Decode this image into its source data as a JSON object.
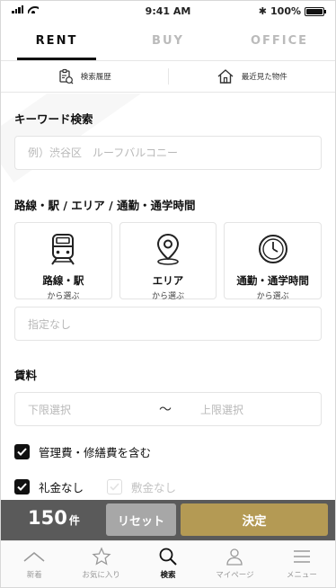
{
  "status": {
    "time": "9:41 AM",
    "battery": "100%"
  },
  "tabs": [
    {
      "label": "RENT",
      "active": true
    },
    {
      "label": "BUY",
      "active": false
    },
    {
      "label": "OFFICE",
      "active": false
    }
  ],
  "history": {
    "search_history": "検索履歴",
    "recently_viewed": "最近見た物件"
  },
  "keyword": {
    "title": "キーワード検索",
    "placeholder": "例）渋谷区　ルーフバルコニー"
  },
  "route": {
    "title": "路線・駅 / エリア / 通勤・通学時間",
    "cards": [
      {
        "label": "路線・駅",
        "sub": "から選ぶ",
        "icon": "train-icon"
      },
      {
        "label": "エリア",
        "sub": "から選ぶ",
        "icon": "map-pin-icon"
      },
      {
        "label": "通勤・通学時間",
        "sub": "から選ぶ",
        "icon": "clock-icon"
      }
    ],
    "selection": "指定なし"
  },
  "rent": {
    "title": "賃料",
    "min_placeholder": "下限選択",
    "separator": "～",
    "max_placeholder": "上限選択"
  },
  "options": [
    {
      "label": "管理費・修繕費を含む",
      "checked": true
    },
    {
      "label": "礼金なし",
      "checked": true
    },
    {
      "label": "敷金なし",
      "checked": false
    }
  ],
  "actions": {
    "count": "150",
    "count_unit": "件",
    "reset": "リセット",
    "decide": "決定"
  },
  "nav": [
    {
      "label": "新着",
      "icon": "chevron-up-icon",
      "active": false
    },
    {
      "label": "お気に入り",
      "icon": "star-icon",
      "active": false
    },
    {
      "label": "検索",
      "icon": "search-icon",
      "active": true
    },
    {
      "label": "マイページ",
      "icon": "user-icon",
      "active": false
    },
    {
      "label": "メニュー",
      "icon": "menu-icon",
      "active": false
    }
  ],
  "colors": {
    "accent_gold": "#b49a54",
    "reset_gray": "#a7a7a7",
    "action_bar": "#5a5a5a"
  }
}
